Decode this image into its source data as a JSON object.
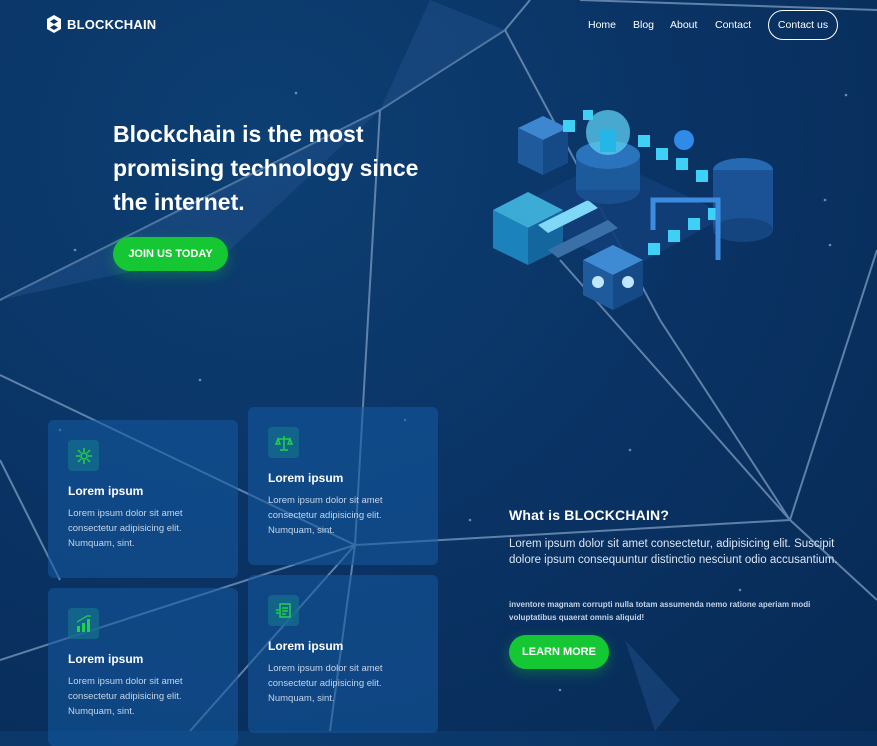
{
  "header": {
    "logo_text": "BLOCKCHAIN",
    "nav": [
      "Home",
      "Blog",
      "About",
      "Contact"
    ],
    "contact_button": "Contact us"
  },
  "hero": {
    "title": "Blockchain is the most promising technology since the internet.",
    "cta": "JOIN US TODAY"
  },
  "cards": [
    {
      "icon": "network-icon",
      "title": "Lorem ipsum",
      "text": "Lorem ipsum dolor sit amet consectetur adipisicing elit. Numquam, sint."
    },
    {
      "icon": "scales-icon",
      "title": "Lorem ipsum",
      "text": "Lorem ipsum dolor sit amet consectetur adipisicing elit. Numquam, sint."
    },
    {
      "icon": "bar-chart-icon",
      "title": "Lorem ipsum",
      "text": "Lorem ipsum dolor sit amet consectetur adipisicing elit. Numquam, sint."
    },
    {
      "icon": "document-icon",
      "title": "Lorem ipsum",
      "text": "Lorem ipsum dolor sit amet consectetur adipisicing elit. Numquam, sint."
    }
  ],
  "about": {
    "title": "What is BLOCKCHAIN?",
    "lead": "Lorem ipsum dolor sit amet consectetur, adipisicing elit. Suscipit dolore ipsum consequuntur distinctio nesciunt odio accusantium.",
    "small": "inventore magnam corrupti nulla totam assumenda nemo ratione aperiam modi voluptatibus quaerat omnis aliquid!",
    "cta": "LEARN MORE"
  },
  "colors": {
    "background": "#0a3466",
    "accent": "#14c733",
    "card_bg": "#145aa0",
    "icon_green": "#22d14a"
  }
}
